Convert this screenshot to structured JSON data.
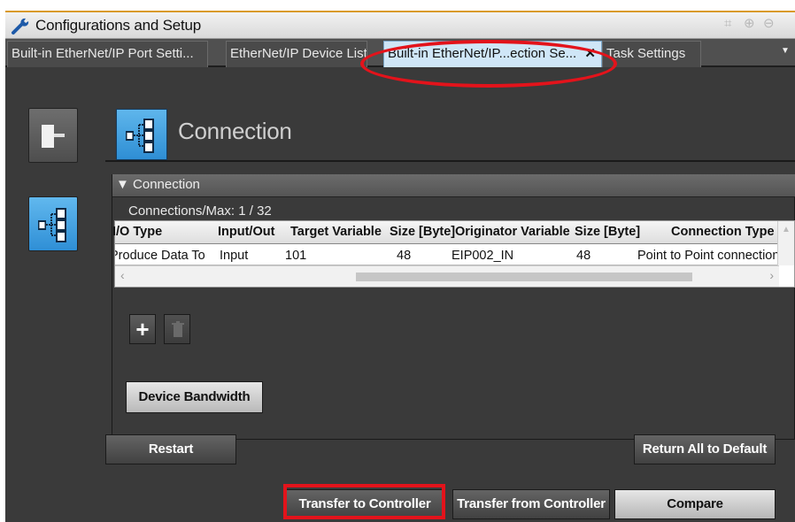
{
  "window": {
    "title": "Configurations and Setup"
  },
  "tabs": [
    {
      "label": "Built-in EtherNet/IP Port Setti..."
    },
    {
      "label": "EtherNet/IP Device List"
    },
    {
      "label": "Built-in EtherNet/IP...ection Se..."
    },
    {
      "label": "Task Settings"
    }
  ],
  "pane": {
    "title": "Connection",
    "section_label": "Connection",
    "connections_max": "Connections/Max: 1 / 32"
  },
  "table": {
    "columns": [
      "I/O Type",
      "Input/Out",
      "Target Variable",
      "Size [Byte]",
      "Originator Variable",
      "Size [Byte]",
      "Connection Type"
    ],
    "rows": [
      [
        "Produce Data To",
        "Input",
        "101",
        "48",
        "EIP002_IN",
        "48",
        "Point to Point connection"
      ]
    ]
  },
  "buttons": {
    "device_bandwidth": "Device Bandwidth",
    "restart": "Restart",
    "return_all_default": "Return All to Default",
    "transfer_to_controller": "Transfer to Controller",
    "transfer_from_controller": "Transfer from Controller",
    "compare": "Compare"
  },
  "colors": {
    "annotation": "#e3131b",
    "active_tab": "#cfe6f7",
    "accent_blue": "#2f8fd6"
  }
}
